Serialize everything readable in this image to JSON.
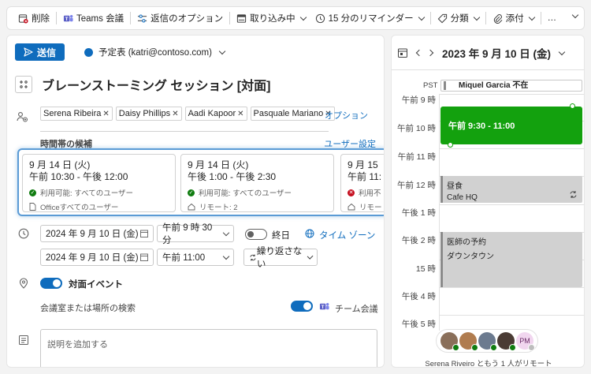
{
  "toolbar": {
    "delete": "削除",
    "teams": "Teams 会議",
    "reply_options": "返信のオプション",
    "busy": "取り込み中",
    "reminder": "15 分のリマインダー",
    "category": "分類",
    "attach": "添付",
    "more": "…"
  },
  "compose": {
    "send": "送信",
    "account": "予定表 (katri@contoso.com)",
    "title": "ブレーンストーミング セッション [対面]",
    "attendees": [
      "Serena Ribeira",
      "Daisy Phillips",
      "Aadi Kapoor",
      "Pasquale Mariano"
    ],
    "options_link": "オプション",
    "suggestions_label": "時間帯の候補",
    "user_settings": "ユーザー設定",
    "suggestions": [
      {
        "date": "9 月 14 日 (火)",
        "time": "午前 10:30 - 午後 12:00",
        "line1": "利用可能: すべてのユーザー",
        "line2": "Officeすべてのユーザー",
        "status": "ok"
      },
      {
        "date": "9 月 14 日 (火)",
        "time": "午後 1:00 - 午後 2:30",
        "line1": "利用可能: すべてのユーザー",
        "line2": "リモート: 2",
        "status": "ok"
      },
      {
        "date": "9 月 15",
        "time": "午前 11:",
        "line1": "利用不",
        "line2": "リモート",
        "status": "bad"
      }
    ],
    "start_date": "2024 年 9 月 10 日 (金)",
    "start_time": "午前 9 時 30 分",
    "allday": "終日",
    "timezone": "タイム ゾーン",
    "end_date": "2024 年 9 月 10 日 (金)",
    "end_time": "午前 11:00",
    "repeat": "繰り返さない",
    "in_person": "対面イベント",
    "room_search": "会議室または場所の検索",
    "teams_meeting": "チーム会議",
    "description_placeholder": "説明を追加する"
  },
  "calendar": {
    "header": "2023 年 9 月 10 日 (金)",
    "timezone": "PST",
    "oof": "Miquel Garcia 不在",
    "hours": [
      "午前 9 時",
      "午前 10 時",
      "午前 11 時",
      "午前 12 時",
      "午後 1 時",
      "午後 2 時",
      "15 時",
      "午後 4 時",
      "午後 5 時"
    ],
    "events": {
      "main": "午前 9:30 - 11:00",
      "lunch_title": "昼食",
      "lunch_loc": "Cafe HQ",
      "doc_title": "医師の予約",
      "doc_loc": "ダウンタウン"
    },
    "avatar_initials": "PM",
    "footer": "Serena Riveiro ともう 1 人がリモート"
  },
  "colors": {
    "accent": "#0f6cbd",
    "event_green": "#13a10e",
    "available": "#107c10",
    "unavailable": "#c50f1f"
  }
}
